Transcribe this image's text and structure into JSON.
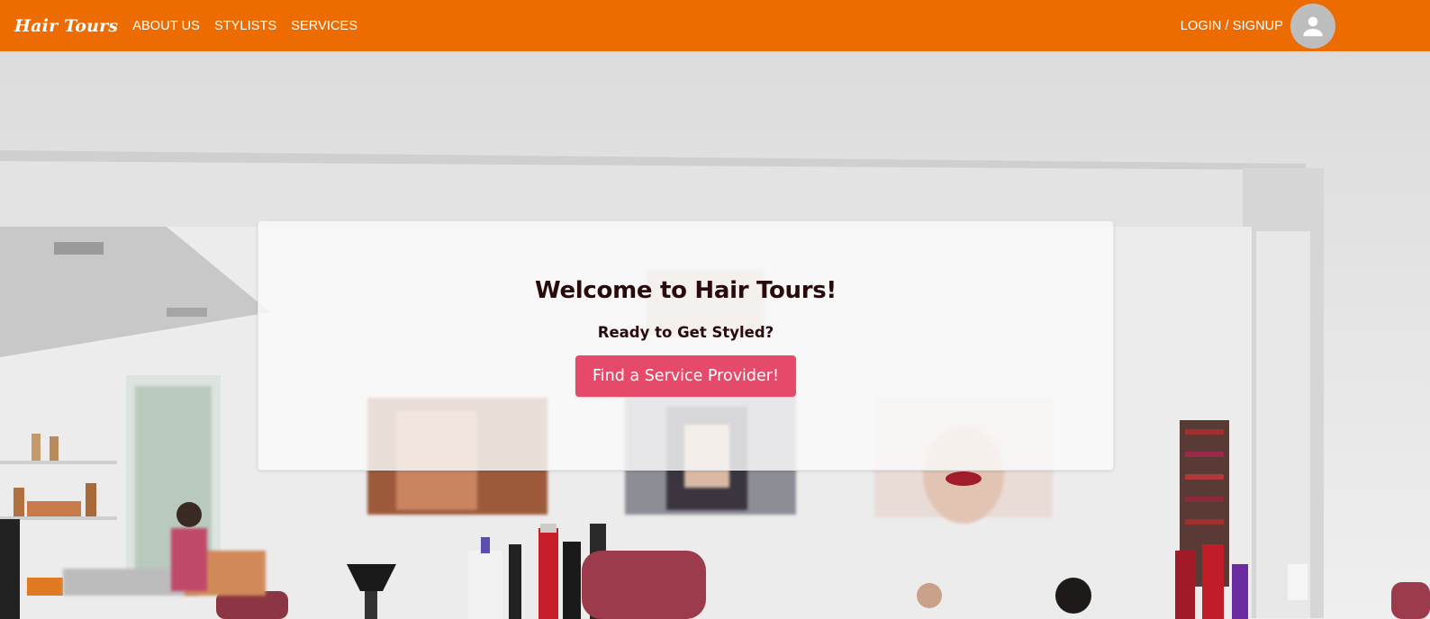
{
  "navbar": {
    "brand": "Hair Tours",
    "links": [
      "ABOUT US",
      "STYLISTS",
      "SERVICES"
    ],
    "login_label": "LOGIN / SIGNUP",
    "avatar_icon": "account-circle-icon",
    "background_color": "#ed6c02"
  },
  "hero": {
    "title": "Welcome to Hair Tours!",
    "subtitle": "Ready to Get Styled?",
    "cta_label": "Find a Service Provider!",
    "cta_color": "#e64a6a"
  }
}
